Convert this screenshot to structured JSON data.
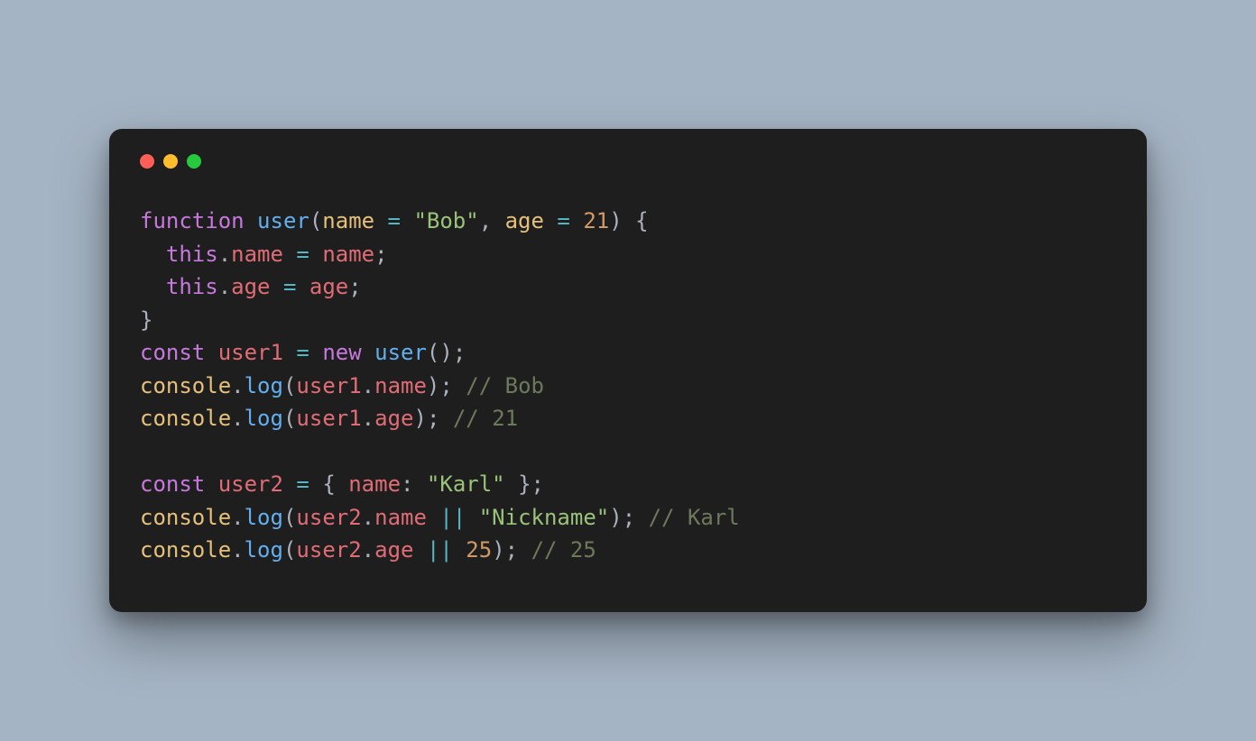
{
  "code": {
    "fnKeyword": "function",
    "fnName": "user",
    "param1": "name",
    "defaultStr": "\"Bob\"",
    "param2": "age",
    "defaultNum": "21",
    "thisKw": "this",
    "assignName": "name",
    "assignNameRhs": "name",
    "assignAge": "age",
    "assignAgeRhs": "age",
    "constKw": "const",
    "user1": "user1",
    "newKw": "new",
    "userCtor": "user",
    "consoleObj": "console",
    "logFn": "log",
    "u1name": "user1",
    "nameProp": "name",
    "cmtBob": "// Bob",
    "u1age": "user1",
    "ageProp": "age",
    "cmt21": "// 21",
    "user2": "user2",
    "nameKey": "name",
    "karlStr": "\"Karl\"",
    "nicknameStr": "\"Nickname\"",
    "cmtKarl": "// Karl",
    "num25": "25",
    "cmt25": "// 25",
    "eq": "=",
    "or": "||"
  }
}
